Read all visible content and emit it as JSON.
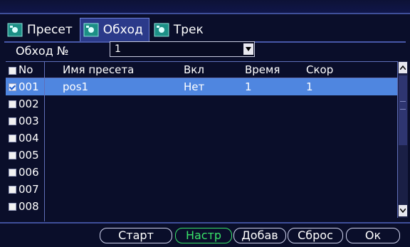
{
  "tabs": [
    {
      "label": "Пресет",
      "icon": "camera-icon",
      "active": false
    },
    {
      "label": "Обход",
      "icon": "camera-icon",
      "active": true
    },
    {
      "label": "Трек",
      "icon": "camera-icon",
      "active": false
    }
  ],
  "tour": {
    "label": "Обход №",
    "value": "1"
  },
  "table": {
    "headers": [
      "No",
      "Имя пресета",
      "Вкл",
      "Время",
      "Скор"
    ],
    "rows": [
      {
        "no": "001",
        "name": "pos1",
        "enabled": "Нет",
        "time": "1",
        "speed": "1",
        "checked": true,
        "selected": true
      },
      {
        "no": "002",
        "name": "",
        "enabled": "",
        "time": "",
        "speed": "",
        "checked": false,
        "selected": false
      },
      {
        "no": "003",
        "name": "",
        "enabled": "",
        "time": "",
        "speed": "",
        "checked": false,
        "selected": false
      },
      {
        "no": "004",
        "name": "",
        "enabled": "",
        "time": "",
        "speed": "",
        "checked": false,
        "selected": false
      },
      {
        "no": "005",
        "name": "",
        "enabled": "",
        "time": "",
        "speed": "",
        "checked": false,
        "selected": false
      },
      {
        "no": "006",
        "name": "",
        "enabled": "",
        "time": "",
        "speed": "",
        "checked": false,
        "selected": false
      },
      {
        "no": "007",
        "name": "",
        "enabled": "",
        "time": "",
        "speed": "",
        "checked": false,
        "selected": false
      },
      {
        "no": "008",
        "name": "",
        "enabled": "",
        "time": "",
        "speed": "",
        "checked": false,
        "selected": false
      }
    ]
  },
  "buttons": {
    "start": "Старт",
    "setup": "Настр",
    "add": "Добав",
    "reset": "Сброс",
    "ok": "Ок"
  },
  "colors": {
    "background": "#0a0e2a",
    "selected_row": "#4f86e0",
    "active_button": "#39e36a",
    "tab_active": "#2b3a8a"
  }
}
